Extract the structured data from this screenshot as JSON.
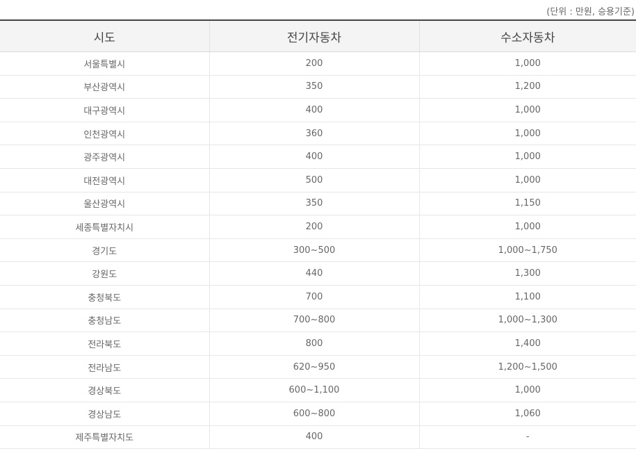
{
  "unit_note": "(단위 : 만원, 승용기준)",
  "table": {
    "headers": [
      "시도",
      "전기자동차",
      "수소자동차"
    ],
    "rows": [
      {
        "region": "서울특별시",
        "ev": "200",
        "fcev": "1,000"
      },
      {
        "region": "부산광역시",
        "ev": "350",
        "fcev": "1,200"
      },
      {
        "region": "대구광역시",
        "ev": "400",
        "fcev": "1,000"
      },
      {
        "region": "인천광역시",
        "ev": "360",
        "fcev": "1,000"
      },
      {
        "region": "광주광역시",
        "ev": "400",
        "fcev": "1,000"
      },
      {
        "region": "대전광역시",
        "ev": "500",
        "fcev": "1,000"
      },
      {
        "region": "울산광역시",
        "ev": "350",
        "fcev": "1,150"
      },
      {
        "region": "세종특별자치시",
        "ev": "200",
        "fcev": "1,000"
      },
      {
        "region": "경기도",
        "ev": "300~500",
        "fcev": "1,000~1,750"
      },
      {
        "region": "강원도",
        "ev": "440",
        "fcev": "1,300"
      },
      {
        "region": "충청북도",
        "ev": "700",
        "fcev": "1,100"
      },
      {
        "region": "충청남도",
        "ev": "700~800",
        "fcev": "1,000~1,300"
      },
      {
        "region": "전라북도",
        "ev": "800",
        "fcev": "1,400"
      },
      {
        "region": "전라남도",
        "ev": "620~950",
        "fcev": "1,200~1,500"
      },
      {
        "region": "경상북도",
        "ev": "600~1,100",
        "fcev": "1,000"
      },
      {
        "region": "경상남도",
        "ev": "600~800",
        "fcev": "1,060"
      },
      {
        "region": "제주특별자치도",
        "ev": "400",
        "fcev": "-"
      }
    ]
  }
}
